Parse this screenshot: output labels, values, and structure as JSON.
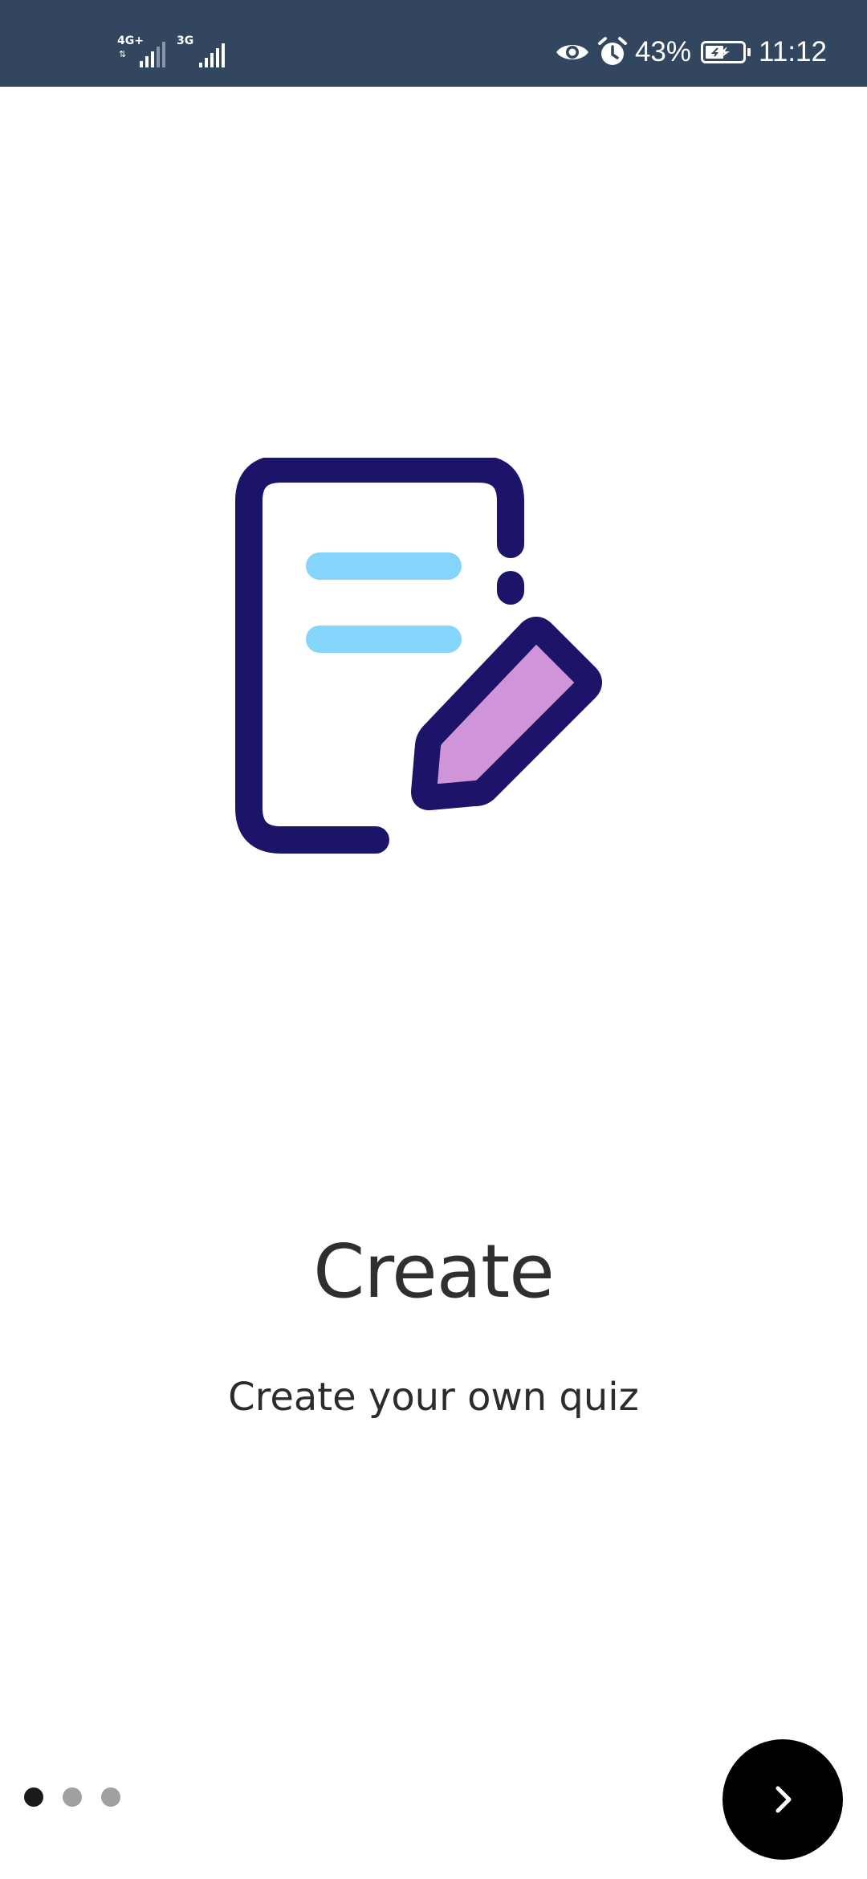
{
  "status_bar": {
    "network_1": "4G+",
    "network_2": "3G",
    "battery_percent": "43%",
    "time": "11:12",
    "icons": [
      "signal-icon",
      "eye-icon",
      "alarm-icon",
      "battery-charging-icon"
    ]
  },
  "onboarding": {
    "title": "Create",
    "subtitle": "Create your own quiz",
    "illustration": "document-edit-icon",
    "page_count": 3,
    "current_page": 1
  },
  "next_button": {
    "icon": "chevron-right-icon"
  },
  "colors": {
    "status_bar_bg": "#32475f",
    "icon_outline": "#1c1468",
    "icon_lines": "#85d4fb",
    "pencil_fill": "#d094d8",
    "fab_bg": "#000000",
    "dot_active": "#1a1a1a",
    "dot_inactive": "#a0a0a0"
  }
}
